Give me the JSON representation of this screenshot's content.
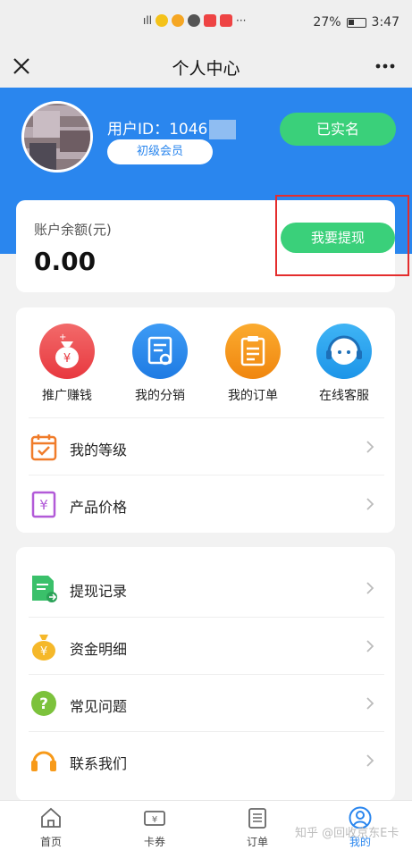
{
  "status": {
    "battery": "27%",
    "time": "3:47"
  },
  "nav": {
    "title": "个人中心"
  },
  "profile": {
    "user_id_label": "用户ID：1046",
    "level": "初级会员",
    "verified_label": "已实名"
  },
  "balance": {
    "label": "账户余额(元)",
    "value": "0.00",
    "withdraw_label": "我要提现"
  },
  "quick_actions": [
    {
      "label": "推广赚钱",
      "icon": "money-bag-icon",
      "color": "#f0525b"
    },
    {
      "label": "我的分销",
      "icon": "certificate-icon",
      "color": "#2f8df0"
    },
    {
      "label": "我的订单",
      "icon": "clipboard-icon",
      "color": "#f79a1a"
    },
    {
      "label": "在线客服",
      "icon": "headset-icon",
      "color": "#2aa8f0"
    }
  ],
  "menu_primary": [
    {
      "label": "我的等级",
      "icon": "calendar-check-icon",
      "color": "#f07c2a"
    },
    {
      "label": "产品价格",
      "icon": "price-tag-icon",
      "color": "#b25ad8"
    }
  ],
  "menu_secondary": [
    {
      "label": "提现记录",
      "icon": "document-arrow-icon",
      "color": "#3ac06a"
    },
    {
      "label": "资金明细",
      "icon": "yen-bag-icon",
      "color": "#f5b82a"
    },
    {
      "label": "常见问题",
      "icon": "question-icon",
      "color": "#7cc23c"
    },
    {
      "label": "联系我们",
      "icon": "headset-icon",
      "color": "#f79a1a"
    }
  ],
  "tabs": [
    {
      "label": "首页",
      "icon": "home-icon"
    },
    {
      "label": "卡券",
      "icon": "ticket-icon"
    },
    {
      "label": "订单",
      "icon": "list-icon"
    },
    {
      "label": "我的",
      "icon": "user-icon",
      "active": true
    }
  ],
  "watermark": "知乎 @回收京东E卡"
}
